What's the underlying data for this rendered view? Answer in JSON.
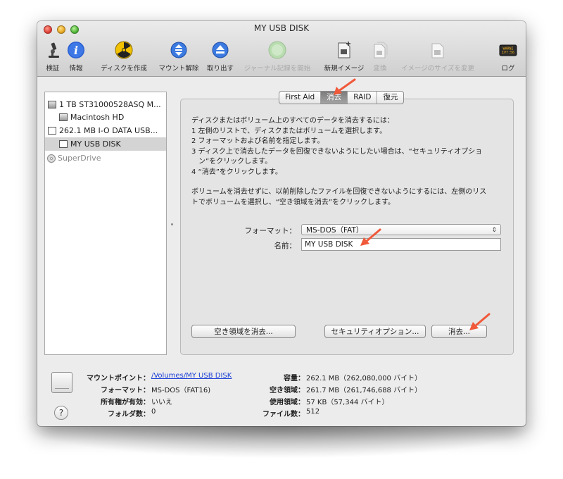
{
  "window": {
    "title": "MY USB DISK"
  },
  "toolbar": {
    "items": [
      {
        "label": "検証",
        "icon": "microscope-icon",
        "enabled": true
      },
      {
        "label": "情報",
        "icon": "info-icon",
        "enabled": true
      },
      {
        "label": "ディスクを作成",
        "icon": "burn-icon",
        "enabled": true
      },
      {
        "label": "マウント解除",
        "icon": "unmount-icon",
        "enabled": true
      },
      {
        "label": "取り出す",
        "icon": "eject-icon",
        "enabled": true
      },
      {
        "label": "ジャーナル記録を開始",
        "icon": "journal-icon",
        "enabled": false
      },
      {
        "label": "新規イメージ",
        "icon": "new-image-icon",
        "enabled": true
      },
      {
        "label": "変換",
        "icon": "convert-icon",
        "enabled": false
      },
      {
        "label": "イメージのサイズを変更",
        "icon": "resize-image-icon",
        "enabled": false
      },
      {
        "label": "ログ",
        "icon": "log-icon",
        "enabled": true
      }
    ],
    "log_icon_text": "WARNI\nIV7:56"
  },
  "sidebar": {
    "items": [
      {
        "label": "1 TB ST31000528ASQ M...",
        "icon": "hard-disk-icon",
        "level": 0
      },
      {
        "label": "Macintosh HD",
        "icon": "volume-icon",
        "level": 1
      },
      {
        "label": "262.1 MB I-O DATA USB...",
        "icon": "usb-disk-icon",
        "level": 0
      },
      {
        "label": "MY USB DISK",
        "icon": "usb-volume-icon",
        "level": 1,
        "selected": true
      },
      {
        "label": "SuperDrive",
        "icon": "optical-drive-icon",
        "level": 0,
        "dimmed": true
      }
    ]
  },
  "tabs": [
    {
      "label": "First Aid",
      "active": false
    },
    {
      "label": "消去",
      "active": true
    },
    {
      "label": "RAID",
      "active": false
    },
    {
      "label": "復元",
      "active": false
    }
  ],
  "erase": {
    "instructions": [
      "ディスクまたはボリューム上のすべてのデータを消去するには：",
      "1 左側のリストで、ディスクまたはボリュームを選択します。",
      "2 フォーマットおよび名前を指定します。",
      "3 ディスク上で消去したデータを回復できないようにしたい場合は、“セキュリティオプショ",
      "　ン”をクリックします。",
      "4 “消去”をクリックします。"
    ],
    "free_space_note": [
      "ボリュームを消去せずに、以前削除したファイルを回復できないようにするには、左側のリス",
      "トでボリュームを選択し、“空き領域を消去”をクリックします。"
    ],
    "format_label": "フォーマット：",
    "format_value": "MS-DOS（FAT）",
    "name_label": "名前：",
    "name_value": "MY USB DISK",
    "erase_free_space_button": "空き領域を消去...",
    "security_options_button": "セキュリティオプション...",
    "erase_button": "消去..."
  },
  "info": {
    "mount_point_label": "マウントポイント：",
    "mount_point_value": "/Volumes/MY USB DISK",
    "format_label": "フォーマット：",
    "format_value": "MS-DOS（FAT16)",
    "owners_label": "所有権が有効：",
    "owners_value": "いいえ",
    "folders_label": "フォルダ数：",
    "folders_value": "0",
    "capacity_label": "容量：",
    "capacity_value": "262.1 MB（262,080,000 バイト）",
    "available_label": "空き領域：",
    "available_value": "261.7 MB（261,746,688 バイト）",
    "used_label": "使用領域：",
    "used_value": "57 KB（57,344 バイト）",
    "files_label": "ファイル数：",
    "files_value": "512"
  },
  "help_label": "?",
  "colors": {
    "annotation_arrow": "#f0593a",
    "selection": "#d4d4d4",
    "link": "#1a3fd6"
  }
}
